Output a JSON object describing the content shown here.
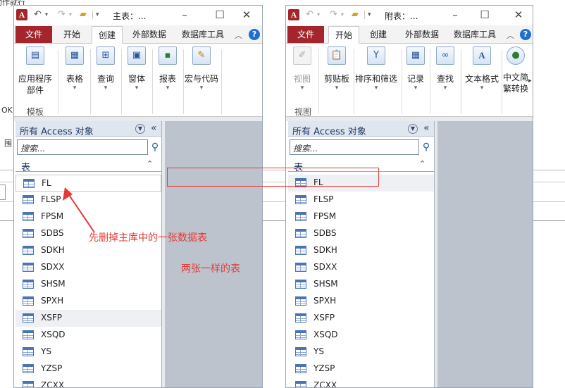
{
  "background": {
    "frag1": "这个动作就行",
    "frag2": "OK",
    "frag3": "围"
  },
  "icons": {
    "app": "access-logo-icon",
    "undo": "undo-icon",
    "redo": "redo-icon",
    "folder": "open-folder-icon",
    "minimize": "minimize-icon",
    "maximize": "maximize-icon",
    "close": "close-icon",
    "help": "help-icon",
    "search": "search-icon",
    "table": "table-icon"
  },
  "colors": {
    "file_tab": "#a4262c",
    "annotation": "#e53935",
    "nav_header": "#dfe6ef"
  },
  "left_window": {
    "title": "主表：...",
    "tabs": {
      "file": "文件",
      "home": "开始",
      "create": "创建",
      "external": "外部数据",
      "dbtools": "数据库工具"
    },
    "ribbon": {
      "app_parts_1": "应用程序",
      "app_parts_2": "部件",
      "table": "表格",
      "query": "查询",
      "form": "窗体",
      "report": "报表",
      "macro": "宏与代码",
      "group": "模板"
    },
    "nav": {
      "title": "所有 Access 对象",
      "search_placeholder": "搜索...",
      "group": "表",
      "items": [
        "FL",
        "FLSP",
        "FPSM",
        "SDBS",
        "SDKH",
        "SDXX",
        "SHSM",
        "SPXH",
        "XSFP",
        "XSQD",
        "YS",
        "YZSP",
        "ZCXX"
      ]
    }
  },
  "right_window": {
    "title": "附表：...",
    "tabs": {
      "file": "文件",
      "home": "开始",
      "create": "创建",
      "external": "外部数据",
      "dbtools": "数据库工具"
    },
    "ribbon": {
      "view": "视图",
      "clipboard": "剪贴板",
      "sort": "排序和筛选",
      "records": "记录",
      "find": "查找",
      "textfmt": "文本格式",
      "convert_1": "中文简",
      "convert_2": "繁转换",
      "group": "视图"
    },
    "nav": {
      "title": "所有 Access 对象",
      "search_placeholder": "搜索...",
      "group": "表",
      "items": [
        "FL",
        "FLSP",
        "FPSM",
        "SDBS",
        "SDKH",
        "SDXX",
        "SHSM",
        "SPXH",
        "XSFP",
        "XSQD",
        "YS",
        "YZSP",
        "ZCXX"
      ]
    }
  },
  "annotations": {
    "delete_note": "先删掉主库中的一张数据表",
    "same_note": "两张一样的表"
  }
}
